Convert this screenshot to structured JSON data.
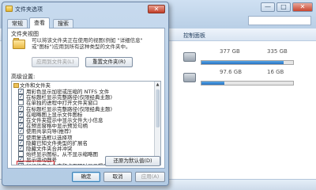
{
  "explorer": {
    "toolbar_item": "控制面板",
    "drives": [
      {
        "used_fraction": 0.9,
        "left_size": "377 GB",
        "right_size": "335 GB"
      },
      {
        "used_fraction": 0.25,
        "left_size": "97.6 GB",
        "right_size": "16 GB"
      }
    ],
    "window_buttons": [
      "—",
      "□",
      "✕"
    ]
  },
  "dialog": {
    "title": "文件夹选项",
    "close_glyph": "✕",
    "tabs": [
      "常规",
      "查看",
      "搜索"
    ],
    "folder_view": {
      "label": "文件夹视图",
      "desc_line1": "可以将该文件夹正在使用的视图(例如 \"详细信息\"",
      "desc_line2": "或\"图标\")应用到所有这种类型的文件夹中。",
      "apply_button": "应用到文件夹(L)",
      "reset_button": "重置文件夹(R)"
    },
    "advanced": {
      "label": "高级设置:",
      "root": "文件和文件夹",
      "items": [
        {
          "label": "用彩色显示加密或压缩的 NTFS 文件",
          "checked": true
        },
        {
          "label": "在标题栏显示完整路径(仅限经典主题)",
          "checked": true
        },
        {
          "label": "在单独的进程中打开文件夹窗口",
          "checked": false
        },
        {
          "label": "在标题栏显示完整路径(仅限经典主题)",
          "checked": true
        },
        {
          "label": "在缩略图上显示文件图标",
          "checked": true
        },
        {
          "label": "在文件夹提示中显示文件大小信息",
          "checked": true
        },
        {
          "label": "在预览窗格中显示预览句柄",
          "checked": true
        },
        {
          "label": "使用共享向导(推荐)",
          "checked": true
        },
        {
          "label": "使用复选框以选择项",
          "checked": true
        },
        {
          "label": "隐藏已知文件类型的扩展名",
          "checked": true
        },
        {
          "label": "隐藏文件夹合并冲突",
          "checked": true
        },
        {
          "label": "始终显示图标，从不显示缩略图",
          "checked": false
        },
        {
          "label": "显示驱动器号",
          "checked": true
        },
        {
          "label": "鼠标指向文件夹和桌面项时显示提示信息",
          "checked": true
        }
      ],
      "restore_button": "还原为默认值(D)"
    },
    "buttons": {
      "ok": "确定",
      "cancel": "取消",
      "apply": "应用(A)"
    }
  }
}
